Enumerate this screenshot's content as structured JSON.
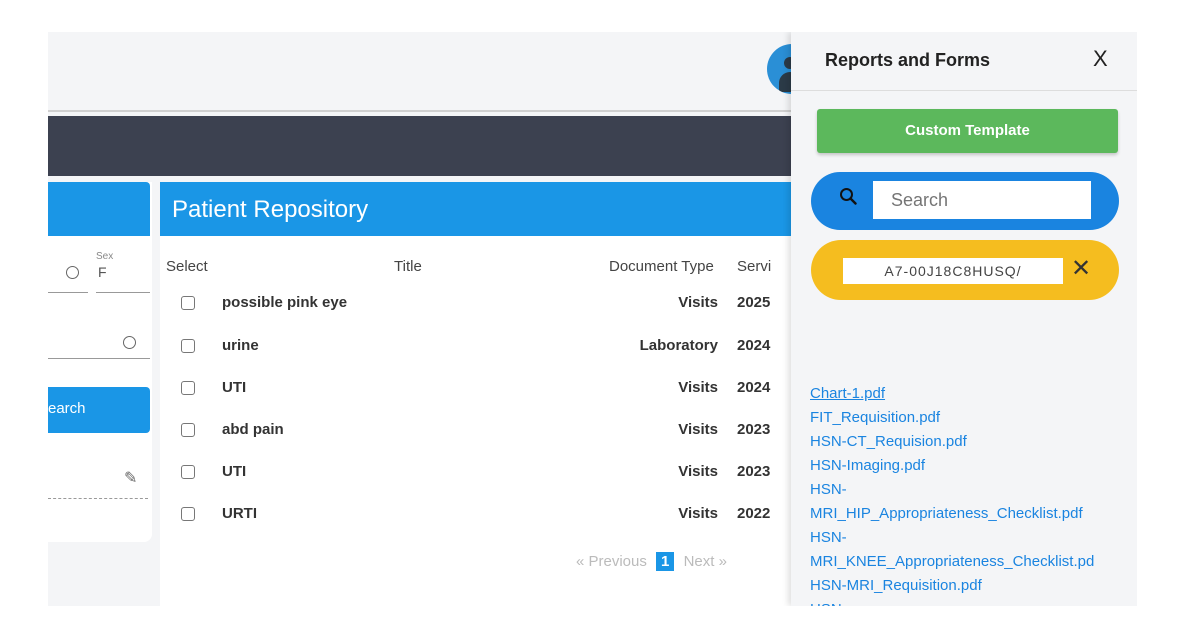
{
  "left": {
    "sex_label": "Sex",
    "sex_value": "F",
    "search_button": "earch"
  },
  "repository": {
    "title": "Patient Repository",
    "headers": {
      "select": "Select",
      "title": "Title",
      "doctype": "Document Type",
      "service": "Servi"
    },
    "rows": [
      {
        "title": "possible pink eye",
        "type": "Visits",
        "date": "2025"
      },
      {
        "title": "urine",
        "type": "Laboratory",
        "date": "2024"
      },
      {
        "title": "UTI",
        "type": "Visits",
        "date": "2024"
      },
      {
        "title": "abd pain",
        "type": "Visits",
        "date": "2023"
      },
      {
        "title": "UTI",
        "type": "Visits",
        "date": "2023"
      },
      {
        "title": "URTI",
        "type": "Visits",
        "date": "2022"
      }
    ],
    "pager": {
      "prev": "« Previous",
      "page": "1",
      "next": "Next »"
    }
  },
  "panel": {
    "title": "Reports and Forms",
    "close": "X",
    "custom_template": "Custom Template",
    "search_placeholder": "Search",
    "filter_chip": "A7-00J18C8HUSQ/",
    "files": [
      "Chart-1.pdf",
      "FIT_Requisition.pdf",
      "HSN-CT_Requision.pdf",
      "HSN-Imaging.pdf",
      "HSN-",
      "MRI_HIP_Appropriateness_Checklist.pdf",
      "HSN-",
      "MRI_KNEE_Appropriateness_Checklist.pd",
      "HSN-MRI_Requisition.pdf",
      "HSN-"
    ]
  },
  "colors": {
    "accent_blue": "#1a96e6",
    "dark_bar": "#3c4150",
    "green": "#5cb85c",
    "yellow": "#f5bd1f",
    "link": "#1a84e0"
  }
}
